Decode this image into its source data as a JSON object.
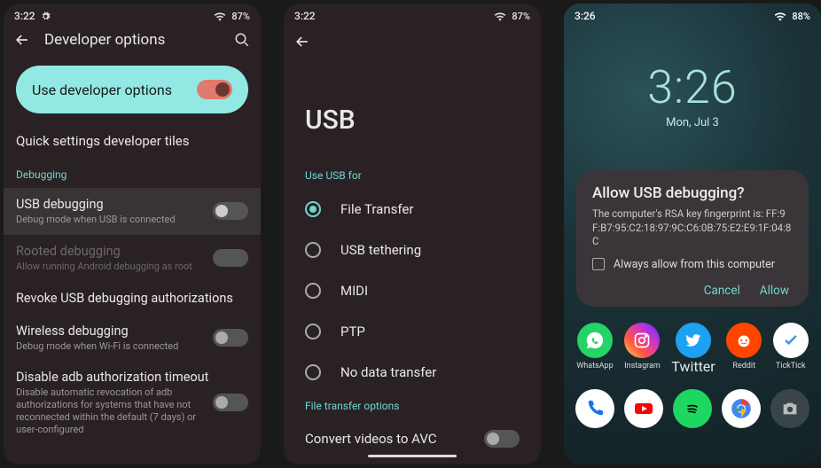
{
  "screen1": {
    "status": {
      "time": "3:22",
      "battery": "87%"
    },
    "appbar_title": "Developer options",
    "master_toggle_label": "Use developer options",
    "quick_tiles_label": "Quick settings developer tiles",
    "debugging_header": "Debugging",
    "rows": {
      "usb_debug": {
        "title": "USB debugging",
        "desc": "Debug mode when USB is connected"
      },
      "rooted": {
        "title": "Rooted debugging",
        "desc": "Allow running Android debugging as root"
      },
      "revoke": {
        "title": "Revoke USB debugging authorizations"
      },
      "wireless": {
        "title": "Wireless debugging",
        "desc": "Debug mode when Wi-Fi is connected"
      },
      "adb_timeout": {
        "title": "Disable adb authorization timeout",
        "desc": "Disable automatic revocation of adb authorizations for systems that have not reconnected within the default (7 days) or user-configured"
      }
    }
  },
  "screen2": {
    "status": {
      "time": "3:22",
      "battery": "87%"
    },
    "title": "USB",
    "use_for_header": "Use USB for",
    "options": {
      "file_transfer": "File Transfer",
      "tether": "USB tethering",
      "midi": "MIDI",
      "ptp": "PTP",
      "none": "No data transfer"
    },
    "ft_header": "File transfer options",
    "convert_label": "Convert videos to AVC"
  },
  "screen3": {
    "status": {
      "time": "3:26",
      "battery": "88%"
    },
    "lock_time": "3:26",
    "lock_date": "Mon, Jul 3",
    "dialog": {
      "title": "Allow USB debugging?",
      "body": "The computer's RSA key fingerprint is:\nFF:9F:B7:95:C2:18:97:9C:C6:0B:75:E2:E9:1F:04:8C",
      "checkbox_label": "Always allow from this computer",
      "cancel": "Cancel",
      "allow": "Allow"
    },
    "apps": {
      "whatsapp": "WhatsApp",
      "instagram": "Instagram",
      "twitter": "Twitter",
      "reddit": "Reddit",
      "ticktick": "TickTick"
    }
  }
}
